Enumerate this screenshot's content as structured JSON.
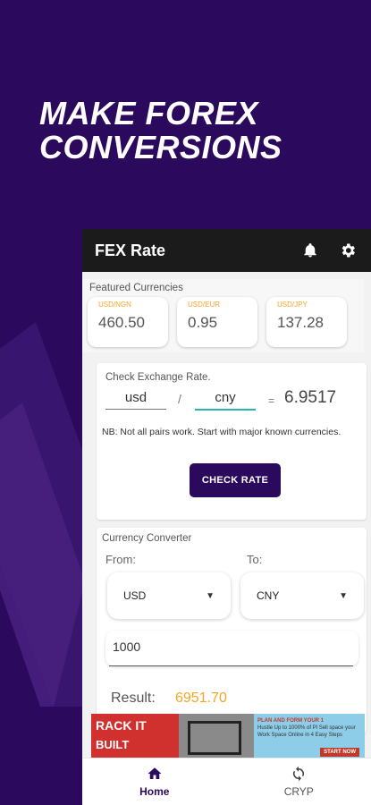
{
  "hero": {
    "line1": "MAKE FOREX",
    "line2": "CONVERSIONS"
  },
  "appbar": {
    "title": "FEX Rate",
    "icons": [
      "bell-icon",
      "gear-icon"
    ]
  },
  "featured": {
    "label": "Featured Currencies",
    "cards": [
      {
        "pair": "USD/NGN",
        "value": "460.50"
      },
      {
        "pair": "USD/EUR",
        "value": "0.95"
      },
      {
        "pair": "USD/JPY",
        "value": "137.28"
      }
    ]
  },
  "check": {
    "label": "Check Exchange Rate.",
    "from": "usd",
    "separator": "/",
    "to": "cny",
    "equals": "=",
    "rate": "6.9517",
    "note": "NB: Not all pairs work. Start with major known currencies.",
    "button": "CHECK RATE"
  },
  "converter": {
    "label": "Currency Converter",
    "from_label": "From:",
    "to_label": "To:",
    "from_value": "USD",
    "to_value": "CNY",
    "amount": "1000",
    "result_label": "Result:",
    "result_value": "6951.70"
  },
  "ad": {
    "brand_line1": "RACK IT",
    "brand_line2": "BUILT",
    "headline": "PLAN AND FORM YOUR 1",
    "desc": "Hustle Up to 1000% of Pl Sell space your Work Space Online in 4 Easy Steps",
    "cta": "START NOW"
  },
  "nav": {
    "home": "Home",
    "cryp": "CRYP"
  },
  "colors": {
    "background": "#2b0a5e",
    "accent": "#f5a623",
    "appbar": "#1b1b1b",
    "focus": "#26b5b0"
  }
}
